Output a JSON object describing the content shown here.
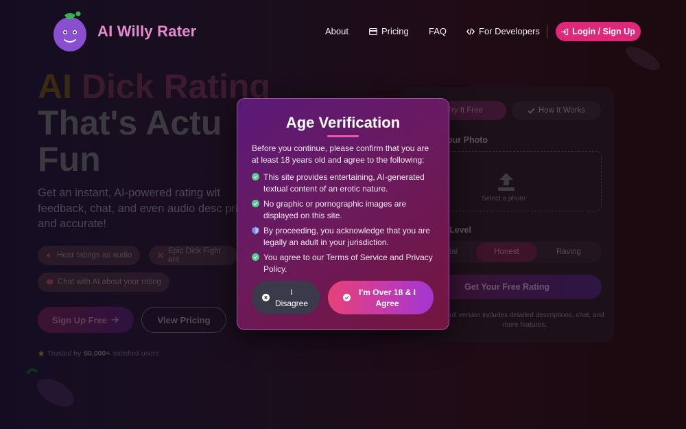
{
  "nav": {
    "brand": "AI Willy Rater",
    "about": "About",
    "pricing": "Pricing",
    "faq": "FAQ",
    "developers": "For Developers",
    "login": "Login / Sign Up"
  },
  "hero": {
    "title_line1_w1": "AI",
    "title_line1_w2": "Dick",
    "title_line1_w3": "Rating",
    "title_line2": "That's Actu",
    "title_line3": "Fun",
    "subtitle": "Get an instant, AI-powered rating wit feedback, chat, and even audio desc private, and accurate!",
    "chips": [
      "Hear ratings as audio",
      "Epic Dick Fight are",
      "Chat with AI about your rating"
    ],
    "signup": "Sign Up Free",
    "view_pricing": "View Pricing",
    "trusted_prefix": "Trusted by",
    "trusted_count": "50,000+",
    "trusted_suffix": "satisfied users"
  },
  "card": {
    "tab_try": "Try It Free",
    "tab_how": "How It Works",
    "upload_label": "our Photo",
    "drop_text": "Select a photo",
    "level_label": "Level",
    "levels": [
      "tal",
      "Honest",
      "Raving"
    ],
    "get_button": "Get Your Free Rating",
    "note": "Full version includes detailed descriptions, chat, and more features."
  },
  "modal": {
    "title": "Age Verification",
    "intro": "Before you continue, please confirm that you are at least 18 years old and agree to the following:",
    "items": [
      {
        "icon": "check-circle-icon",
        "text": "This site provides entertaining, AI-generated textual content of an erotic nature."
      },
      {
        "icon": "check-circle-icon",
        "text": "No graphic or pornographic images are displayed on this site."
      },
      {
        "icon": "shield-icon",
        "text": "By proceeding, you acknowledge that you are legally an adult in your jurisdiction."
      },
      {
        "icon": "check-circle-icon",
        "text": "You agree to our Terms of Service and Privacy Policy."
      }
    ],
    "disagree": "I Disagree",
    "agree": "I'm Over 18 & I Agree"
  },
  "colors": {
    "brand": "#e98ad0",
    "accent": "#e0287a",
    "check": "#4ed08a",
    "shield": "#7a8cf0"
  }
}
